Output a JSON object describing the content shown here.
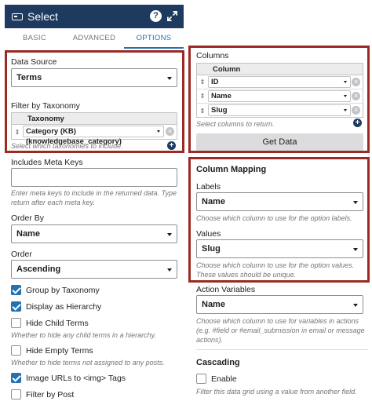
{
  "header": {
    "title": "Select",
    "help_icon": "question-icon",
    "expand_icon": "expand-icon",
    "help_glyph": "?"
  },
  "tabs": [
    {
      "label": "BASIC"
    },
    {
      "label": "ADVANCED"
    },
    {
      "label": "OPTIONS",
      "active": true
    }
  ],
  "left": {
    "data_source": {
      "label": "Data Source",
      "value": "Terms"
    },
    "taxonomy": {
      "label": "Filter by Taxonomy",
      "column_header": "Taxonomy",
      "rows": [
        {
          "value": "Category (KB) (knowledgebase_category)"
        }
      ],
      "hint": "Select which taxonomies to include."
    },
    "meta_keys": {
      "label": "Includes Meta Keys",
      "value": "",
      "hint_line1": "Enter meta keys to include in the returned data. Type",
      "hint_line2": "return after each meta key."
    },
    "order_by": {
      "label": "Order By",
      "value": "Name"
    },
    "order": {
      "label": "Order",
      "value": "Ascending"
    },
    "checkboxes": [
      {
        "label": "Group by Taxonomy",
        "checked": true
      },
      {
        "label": "Display as Hierarchy",
        "checked": true
      },
      {
        "label": "Hide Child Terms",
        "checked": false,
        "hint": "Whether to hide any child terms in a hierarchy."
      },
      {
        "label": "Hide Empty Terms",
        "checked": false,
        "hint": "Whether to hide terms not assigned to any posts."
      },
      {
        "label": "Image URLs to <img> Tags",
        "checked": true
      },
      {
        "label": "Filter by Post",
        "checked": false
      }
    ]
  },
  "right": {
    "columns": {
      "label": "Columns",
      "column_header": "Column",
      "rows": [
        {
          "value": "ID"
        },
        {
          "value": "Name"
        },
        {
          "value": "Slug"
        }
      ],
      "hint": "Select columns to return.",
      "get_data_label": "Get Data"
    },
    "mapping": {
      "title": "Column Mapping",
      "labels": {
        "label": "Labels",
        "value": "Name",
        "hint": "Choose which column to use for the option labels."
      },
      "values": {
        "label": "Values",
        "value": "Slug",
        "hint_line1": "Choose which column to use for the option values.",
        "hint_line2": "These values should be unique."
      }
    },
    "action_variables": {
      "label": "Action Variables",
      "value": "Name",
      "hint_line1": "Choose which column to use for variables in actions",
      "hint_line2": "(e.g. #field or #email_submission in email or message",
      "hint_line3": "actions)."
    },
    "cascading": {
      "title": "Cascading",
      "enable_label": "Enable",
      "enabled": false,
      "hint": "Filter this data grid using a value from another field."
    }
  },
  "colors": {
    "header_bg": "#1e3a5f",
    "accent": "#2271b1",
    "highlight_border": "#9c2a23"
  }
}
